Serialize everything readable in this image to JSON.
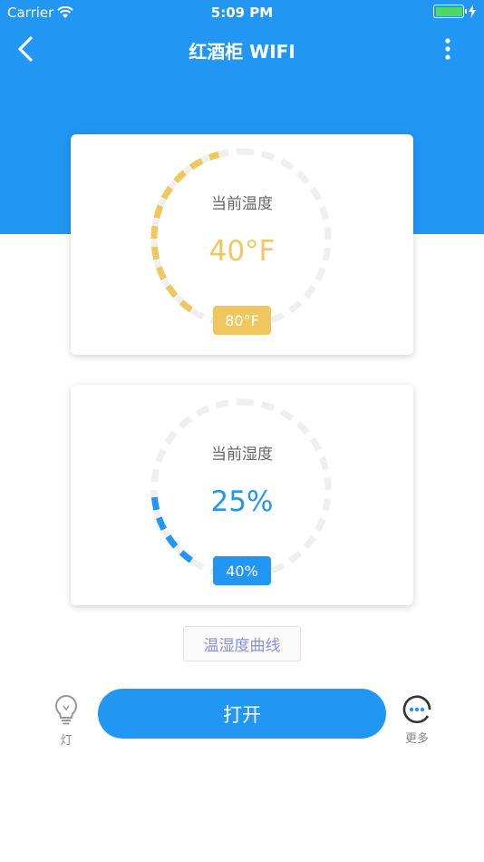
{
  "status_bar": {
    "carrier": "Carrier",
    "time": "5:09 PM"
  },
  "nav": {
    "title": "红酒柜 WIFI",
    "back_icon": "chevron-left-icon",
    "menu_icon": "more-vertical-icon"
  },
  "temperature": {
    "label": "当前温度",
    "value": "40°F",
    "setpoint": "80°F",
    "color": "#f0c75e",
    "track_color": "#efefef"
  },
  "humidity": {
    "label": "当前湿度",
    "value": "25%",
    "setpoint": "40%",
    "color": "#2196f3",
    "track_color": "#efefef"
  },
  "curve_button": {
    "label": "温湿度曲线"
  },
  "bottom": {
    "light_label": "灯",
    "open_label": "打开",
    "more_label": "更多"
  },
  "colors": {
    "primary": "#2196f3",
    "temperature_accent": "#f0c75e"
  }
}
